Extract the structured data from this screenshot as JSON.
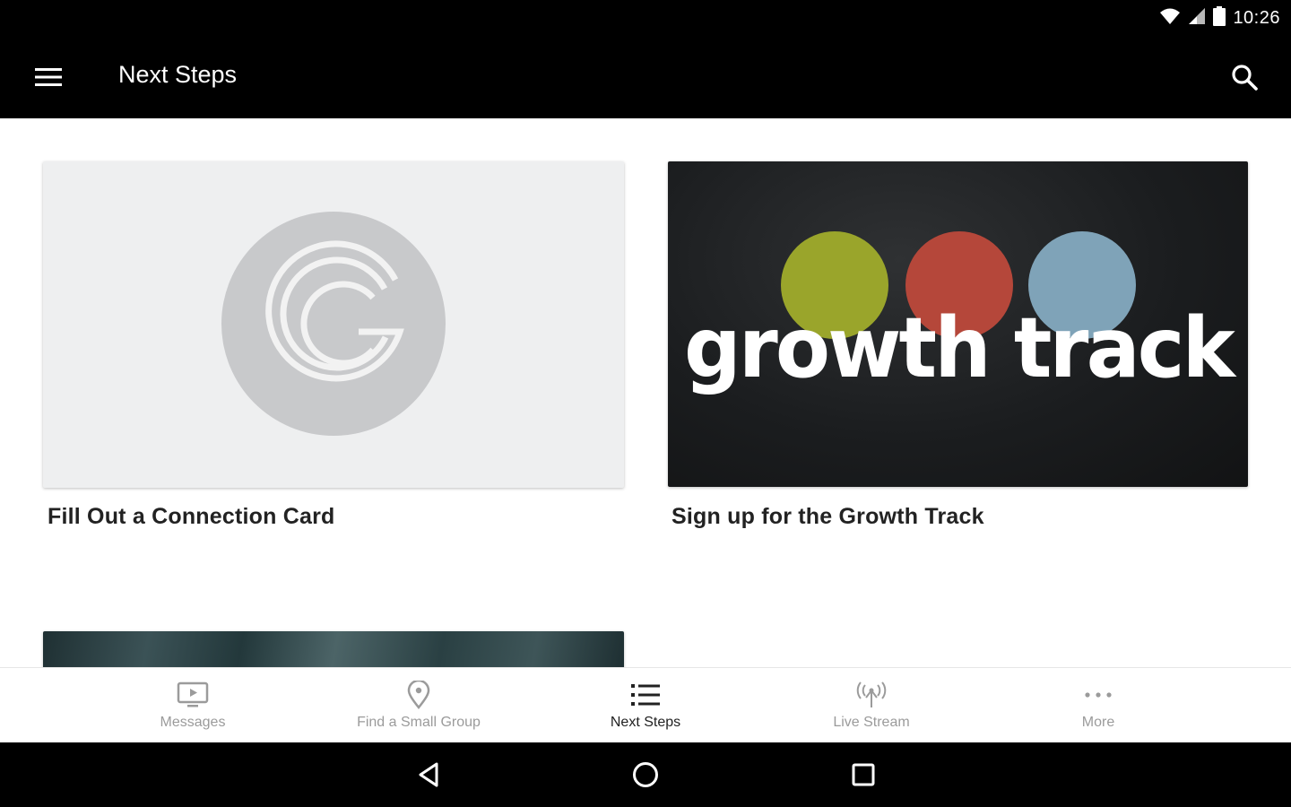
{
  "status_bar": {
    "time": "10:26",
    "icons": [
      "wifi-icon",
      "signal-icon",
      "battery-icon"
    ]
  },
  "app_bar": {
    "title": "Next Steps",
    "menu_icon": "hamburger-menu-icon",
    "search_icon": "search-icon"
  },
  "cards": [
    {
      "label": "Fill Out a Connection Card",
      "image": "church-logo"
    },
    {
      "label": "Sign up for the Growth Track",
      "image_text": "growth track",
      "dot_colors": [
        "#9aa52b",
        "#b5473a",
        "#7fa3b8"
      ]
    },
    {
      "label": "",
      "image": "ocean-texture"
    }
  ],
  "bottom_nav": {
    "items": [
      {
        "label": "Messages",
        "icon": "tv-play-icon",
        "active": false
      },
      {
        "label": "Find a Small Group",
        "icon": "map-pin-icon",
        "active": false
      },
      {
        "label": "Next Steps",
        "icon": "list-icon",
        "active": true
      },
      {
        "label": "Live Stream",
        "icon": "broadcast-icon",
        "active": false
      },
      {
        "label": "More",
        "icon": "more-dots-icon",
        "active": false
      }
    ]
  },
  "system_nav": {
    "buttons": [
      "back-icon",
      "home-icon",
      "recents-icon"
    ]
  },
  "colors": {
    "app_bar_bg": "#000000",
    "card_placeholder_bg": "#eeeff0",
    "logo_circle": "#c8c9cb",
    "nav_inactive": "#9b9b9b",
    "nav_active": "#222222"
  }
}
